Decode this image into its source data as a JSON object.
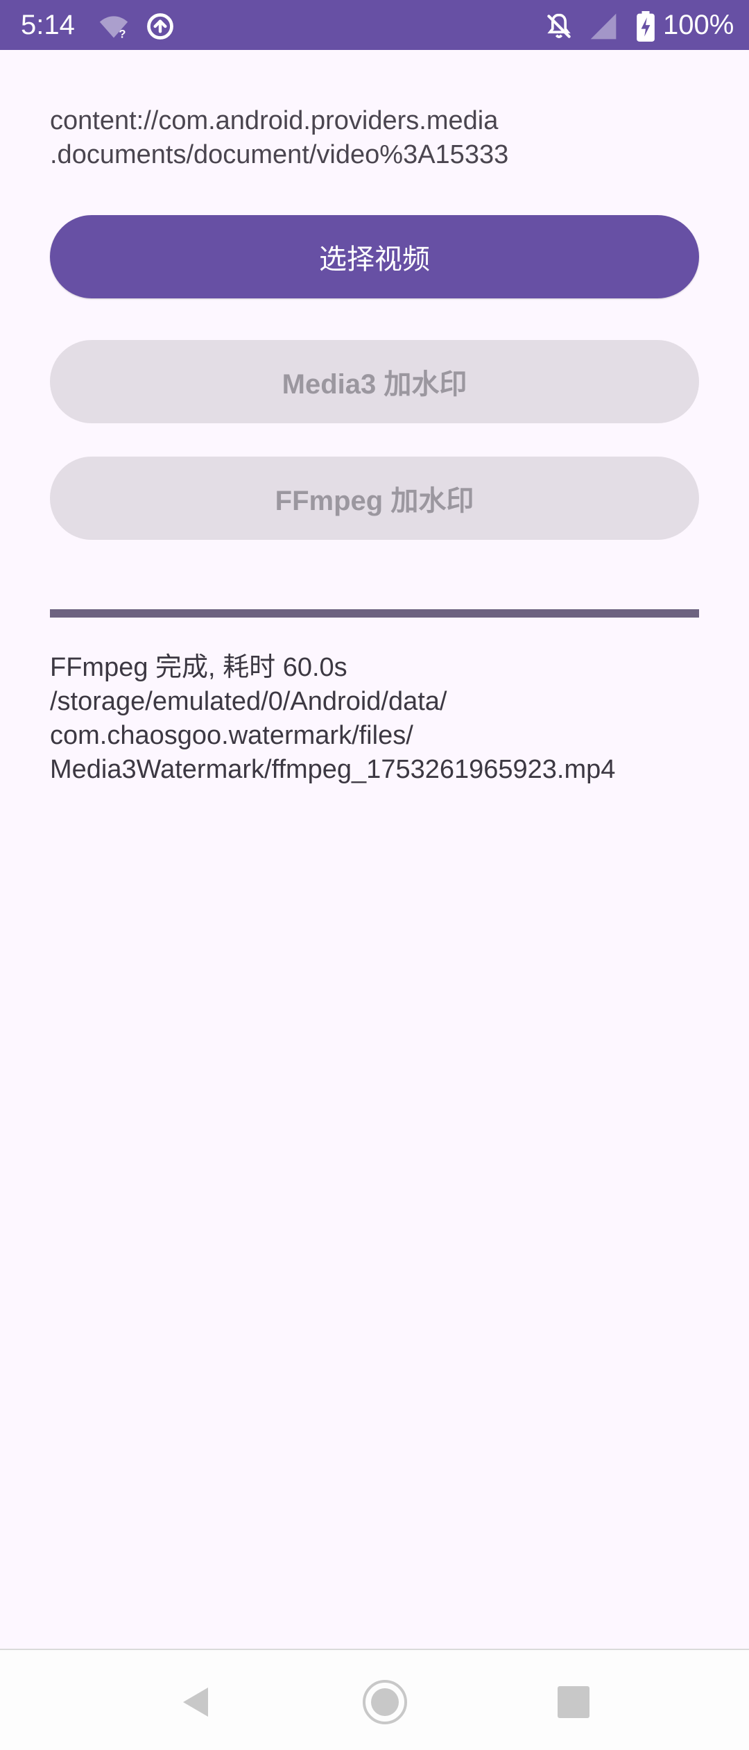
{
  "status_bar": {
    "time": "5:14",
    "battery_text": "100%",
    "background_color": "#6750a4",
    "icons": [
      "wifi-unknown-icon",
      "data-saver-icon",
      "notifications-off-icon",
      "signal-icon",
      "battery-charging-icon"
    ]
  },
  "main": {
    "uri_text": "content://com.android.providers.media\n.documents/document/video%3A15333",
    "select_video_label": "选择视频",
    "media3_label": "Media3 加水印",
    "ffmpeg_label": "FFmpeg 加水印",
    "progress_fraction": 1.0,
    "result_text": "FFmpeg 完成, 耗时 60.0s\n/storage/emulated/0/Android/data/\ncom.chaosgoo.watermark/files/\nMedia3Watermark/ffmpeg_1753261965923.mp4"
  },
  "colors": {
    "primary": "#6750a4",
    "background": "#fdf7ff",
    "disabled_container": "#e3dde5",
    "disabled_text": "#9b979f",
    "progress": "#6d6380"
  },
  "nav_bar": {
    "icons": [
      "back-icon",
      "home-icon",
      "recents-icon"
    ]
  }
}
